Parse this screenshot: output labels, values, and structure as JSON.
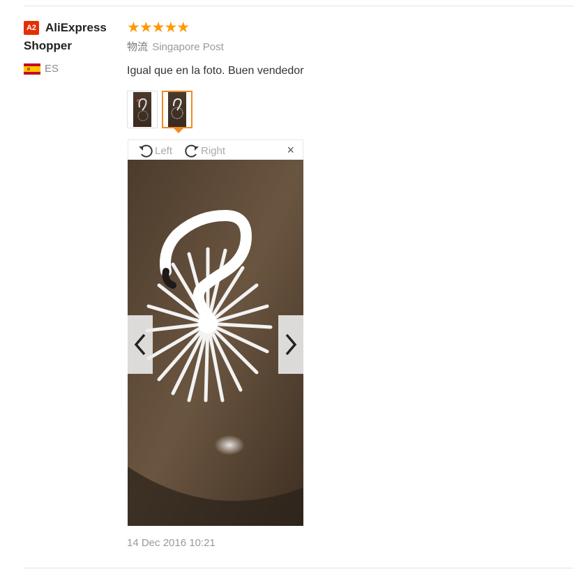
{
  "user": {
    "level_badge": "A2",
    "name_line1": "AliExpress",
    "name_line2": "Shopper",
    "country_code": "ES",
    "flag_icon": "spain-flag-icon"
  },
  "review": {
    "rating": 5,
    "stars": "★★★★★",
    "star_color": "#ff9900",
    "shipping_label": "物流",
    "shipping_method": "Singapore Post",
    "comment": "Igual que en la foto. Buen vendedor",
    "date": "14 Dec 2016 10:21"
  },
  "viewer": {
    "rotate_left_label": "Left",
    "rotate_right_label": "Right",
    "close_glyph": "×",
    "thumbnail_count": 2,
    "active_thumbnail": 2
  },
  "colors": {
    "badge": "#e62e04",
    "accent": "#f08a24",
    "muted_text": "#999999"
  }
}
